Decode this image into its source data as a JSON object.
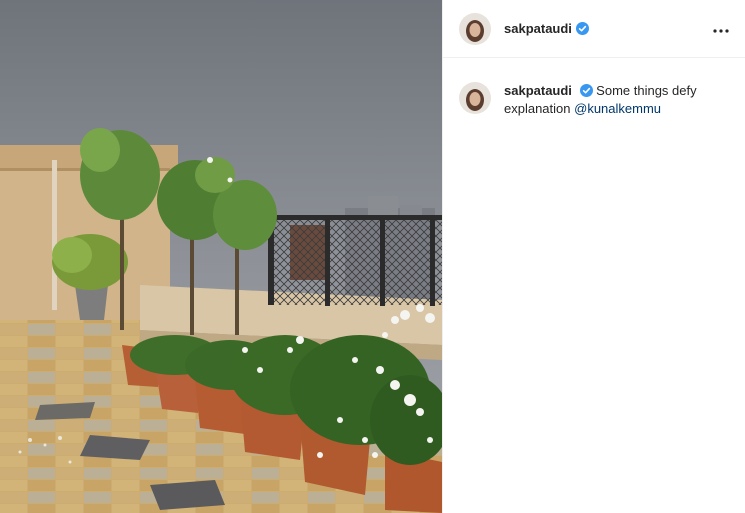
{
  "post": {
    "username": "sakpataudi",
    "verified": true,
    "caption": {
      "username": "sakpataudi",
      "text": "Some things defy explanation",
      "mention": "@kunalkemmu"
    }
  },
  "icons": {
    "verified": "verified-badge-icon",
    "more": "more-horizontal-icon"
  },
  "colors": {
    "verified_blue": "#3897f0",
    "mention": "#00376b",
    "text": "#262626",
    "border": "#efefef"
  }
}
